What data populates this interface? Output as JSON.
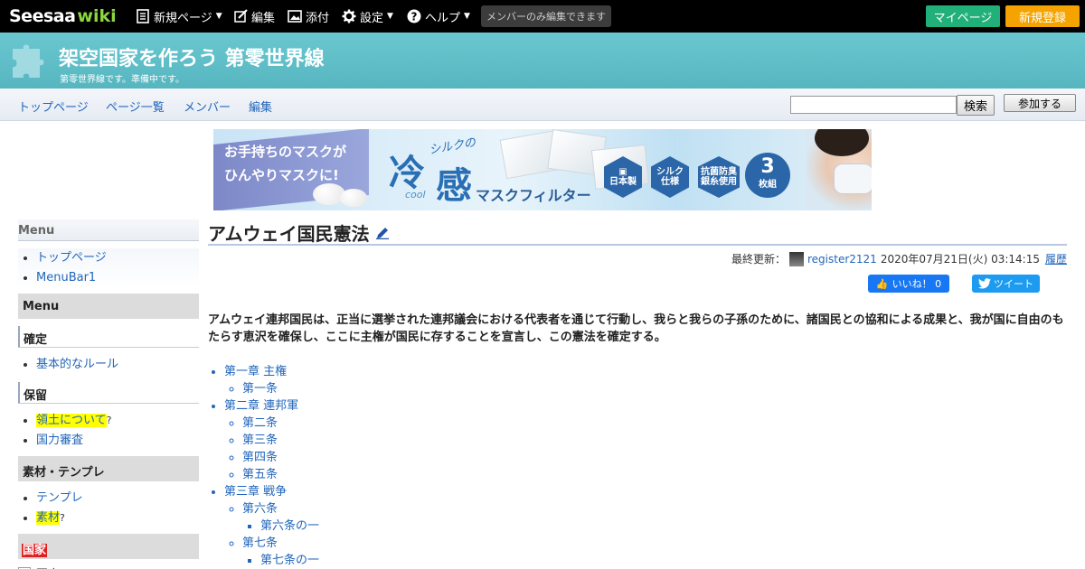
{
  "topbar": {
    "logo_main": "Seesaa",
    "logo_wiki": "wiki",
    "new_page": "新規ページ",
    "edit": "編集",
    "attach": "添付",
    "settings": "設定",
    "help": "ヘルプ",
    "members_only": "メンバーのみ編集できます",
    "mypage": "マイページ",
    "register": "新規登録"
  },
  "header": {
    "title": "架空国家を作ろう 第零世界線",
    "subtitle": "第零世界線です。準備中です。"
  },
  "nav": {
    "links": [
      "トップページ",
      "ページ一覧",
      "メンバー",
      "編集"
    ],
    "search_button": "検索",
    "join_button": "参加する"
  },
  "ad": {
    "line1": "お手持ちのマスクが",
    "line2": "ひんやりマスクに!",
    "silk_no": "シルクの",
    "rei": "冷",
    "kan": "感",
    "cool": "cool",
    "filter": "マスクフィルター",
    "badge1": "日本製",
    "badge2a": "シルク",
    "badge2b": "仕様",
    "badge3a": "抗菌防臭",
    "badge3b": "銀糸使用",
    "count_num": "3",
    "count_unit": "枚組"
  },
  "sidebar": {
    "menu_head": "Menu",
    "menu_items": [
      "トップページ",
      "MenuBar1"
    ],
    "menu_block": "Menu",
    "kakutei_head": "確定",
    "kakutei_items": [
      "基本的なルール"
    ],
    "horyu_head": "保留",
    "horyu_item1": "領土について",
    "horyu_item1_q": "?",
    "horyu_item2": "国力審査",
    "sozai_head": "素材・テンプレ",
    "sozai_item1": "テンプレ",
    "sozai_item2": "素材",
    "sozai_item2_q": "?",
    "kokka_head": "国家",
    "tree_item": "国家",
    "tree_toggle": "+"
  },
  "main": {
    "title": "アムウェイ国民憲法",
    "meta_label": "最終更新：",
    "meta_user": "register2121",
    "meta_date": "2020年07月21日(火) 03:14:15",
    "meta_history": "履歴",
    "fb_like": "いいね！ 0",
    "tweet": "ツイート",
    "preamble": "アムウェイ連邦国民は、正当に選挙された連邦議会における代表者を通じて行動し、我らと我らの子孫のために、諸国民との協和による成果と、我が国に自由のもたらす恵沢を確保し、ここに主権が国民に存することを宣言し、この憲法を確定する。",
    "toc": {
      "ch1": "第一章 主権",
      "a1": "第一条",
      "ch2": "第二章 連邦軍",
      "a2": "第二条",
      "a3": "第三条",
      "a4": "第四条",
      "a5": "第五条",
      "ch3": "第三章 戦争",
      "a6": "第六条",
      "a6_1": "第六条の一",
      "a7": "第七条",
      "a7_1": "第七条の一"
    }
  },
  "colors": {
    "topbar_bg": "#000000",
    "header_bg": "#5fbec8",
    "mypage_btn": "#21b07a",
    "register_btn": "#f5a300",
    "link": "#2266bb"
  }
}
